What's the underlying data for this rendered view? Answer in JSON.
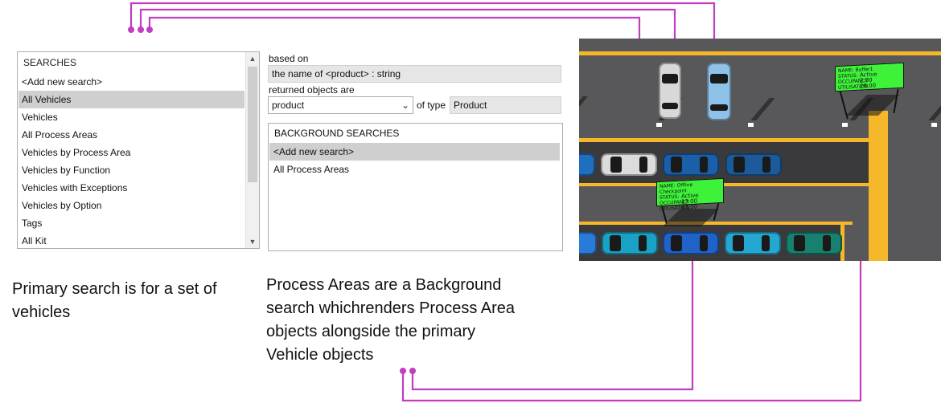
{
  "searches_panel": {
    "header": "SEARCHES",
    "items": [
      {
        "label": "<Add new search>",
        "selected": false
      },
      {
        "label": "All Vehicles",
        "selected": true
      },
      {
        "label": "Vehicles",
        "selected": false
      },
      {
        "label": "All Process Areas",
        "selected": false
      },
      {
        "label": "Vehicles by Process Area",
        "selected": false
      },
      {
        "label": "Vehicles by Function",
        "selected": false
      },
      {
        "label": "Vehicles with Exceptions",
        "selected": false
      },
      {
        "label": "Vehicles by Option",
        "selected": false
      },
      {
        "label": "Tags",
        "selected": false
      },
      {
        "label": "All Kit",
        "selected": false
      }
    ],
    "scroll_up_icon": "chevron-up-icon",
    "scroll_down_icon": "chevron-down-icon"
  },
  "details": {
    "based_on_label": "based on",
    "based_on_value": "the name of <product> : string",
    "returned_label": "returned objects are",
    "returned_value": "product",
    "of_type_label": "of type",
    "of_type_value": "Product",
    "dropdown_icon": "chevron-down-icon"
  },
  "background_searches": {
    "header": "BACKGROUND SEARCHES",
    "items": [
      {
        "label": "<Add new search>",
        "selected": true
      },
      {
        "label": "All Process Areas",
        "selected": false
      }
    ]
  },
  "captions": {
    "primary": [
      "Primary search is for a set of",
      "vehicles"
    ],
    "background": [
      "Process Areas are a Background",
      "search whichrenders Process  Area",
      "objects alongside the primary",
      "Vehicle objects"
    ]
  },
  "map": {
    "tags": [
      {
        "name_label": "NAME:",
        "name_value": "Buffer1",
        "status_label": "STATUS:",
        "status_value": "Active",
        "occupancy_label": "OCCUPANCY",
        "occupancy_value": "2.00",
        "utilisation_label": "UTILISATION",
        "utilisation_value": "20.00"
      },
      {
        "name_label": "NAME:",
        "name_value": "Offline Checkpoint",
        "status_label": "STATUS:",
        "status_value": "Active",
        "occupancy_label": "OCCUPANCY",
        "occupancy_value": "13.00",
        "utilisation_label": "UTILISATION",
        "utilisation_value": "43.00"
      }
    ]
  },
  "colors": {
    "connector": "#c13ec1",
    "road_yellow": "#f5b82a",
    "tag_green": "#3ef23a"
  }
}
